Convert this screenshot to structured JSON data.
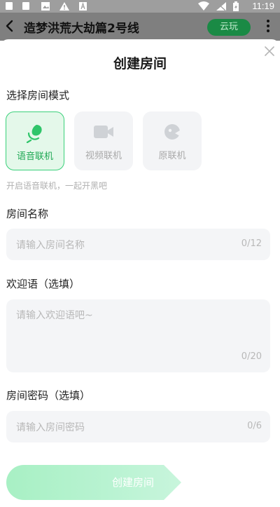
{
  "status_bar": {
    "time": "11:19"
  },
  "app_bar": {
    "title": "造梦洪荒大劫篇2号线",
    "cloud_label": "云玩"
  },
  "sheet": {
    "title": "创建房间",
    "mode_section_label": "选择房间模式",
    "modes": [
      {
        "label": "语音联机",
        "icon": "microphone-icon",
        "selected": true
      },
      {
        "label": "视频联机",
        "icon": "video-camera-icon",
        "selected": false
      },
      {
        "label": "原联机",
        "icon": "gamepad-icon",
        "selected": false
      }
    ],
    "mode_hint": "开启语音联机，一起开黑吧",
    "room_name": {
      "label": "房间名称",
      "placeholder": "请输入房间名称",
      "counter": "0/12"
    },
    "welcome": {
      "label": "欢迎语（选填）",
      "placeholder": "请输入欢迎语吧~",
      "counter": "0/20"
    },
    "password": {
      "label": "房间密码（选填）",
      "placeholder": "请输入房间密码",
      "counter": "0/6"
    },
    "create_label": "创建房间"
  },
  "colors": {
    "accent": "#3ad07a",
    "accent_text": "#1fa854",
    "field_bg": "#f4f5f7"
  }
}
